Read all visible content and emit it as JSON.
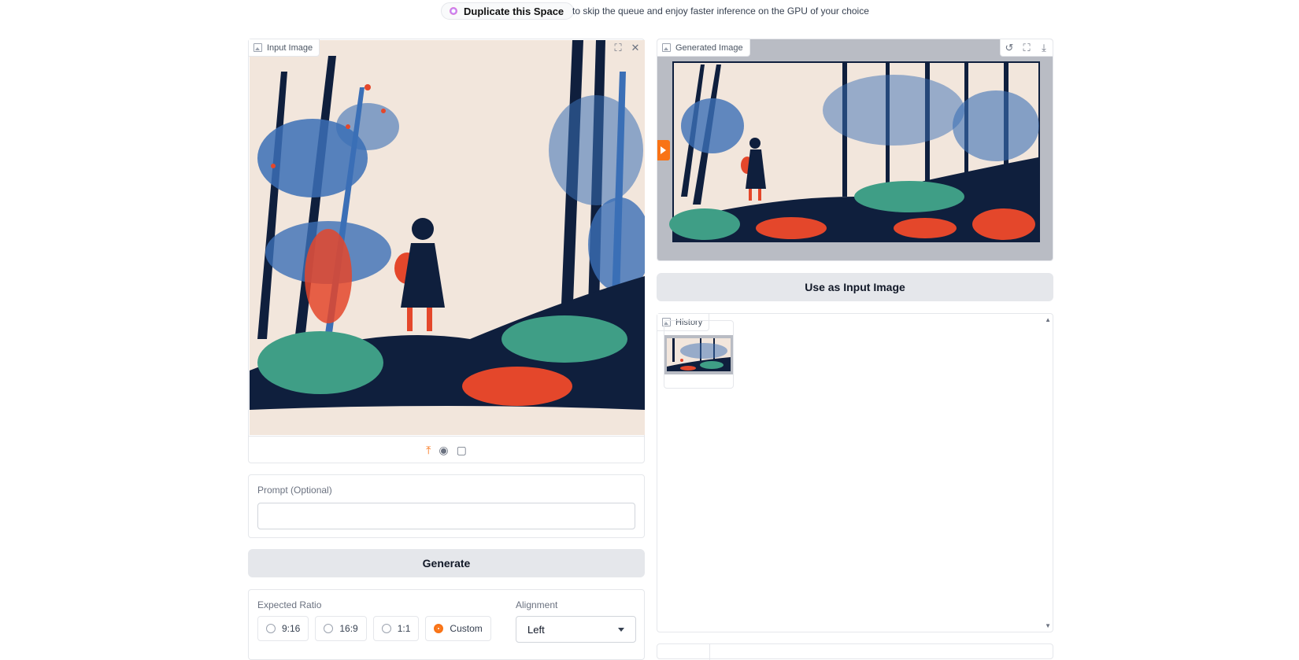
{
  "banner": {
    "duplicate_label": "Duplicate this Space",
    "duplicate_note": "to skip the queue and enjoy faster inference on the GPU of your choice"
  },
  "input_image": {
    "label": "Input Image",
    "icons": [
      "fullscreen-icon",
      "close-icon",
      "upload-icon",
      "webcam-icon",
      "clipboard-icon"
    ]
  },
  "prompt": {
    "label": "Prompt (Optional)",
    "value": "",
    "placeholder": ""
  },
  "generate": {
    "label": "Generate"
  },
  "ratio": {
    "label": "Expected Ratio",
    "options": [
      "9:16",
      "16:9",
      "1:1",
      "Custom"
    ],
    "selected": "Custom"
  },
  "alignment": {
    "label": "Alignment",
    "value": "Left"
  },
  "generated_image": {
    "label": "Generated Image",
    "icons": [
      "undo-icon",
      "fullscreen-icon",
      "download-icon"
    ]
  },
  "use_input": {
    "label": "Use as Input Image"
  },
  "history": {
    "label": "History"
  },
  "colors": {
    "accent": "#f97316",
    "navy": "#0f1f3d",
    "blue": "#3b6fb6",
    "teal": "#3f9e86",
    "red": "#e4472b",
    "paper": "#f2e6dc"
  }
}
